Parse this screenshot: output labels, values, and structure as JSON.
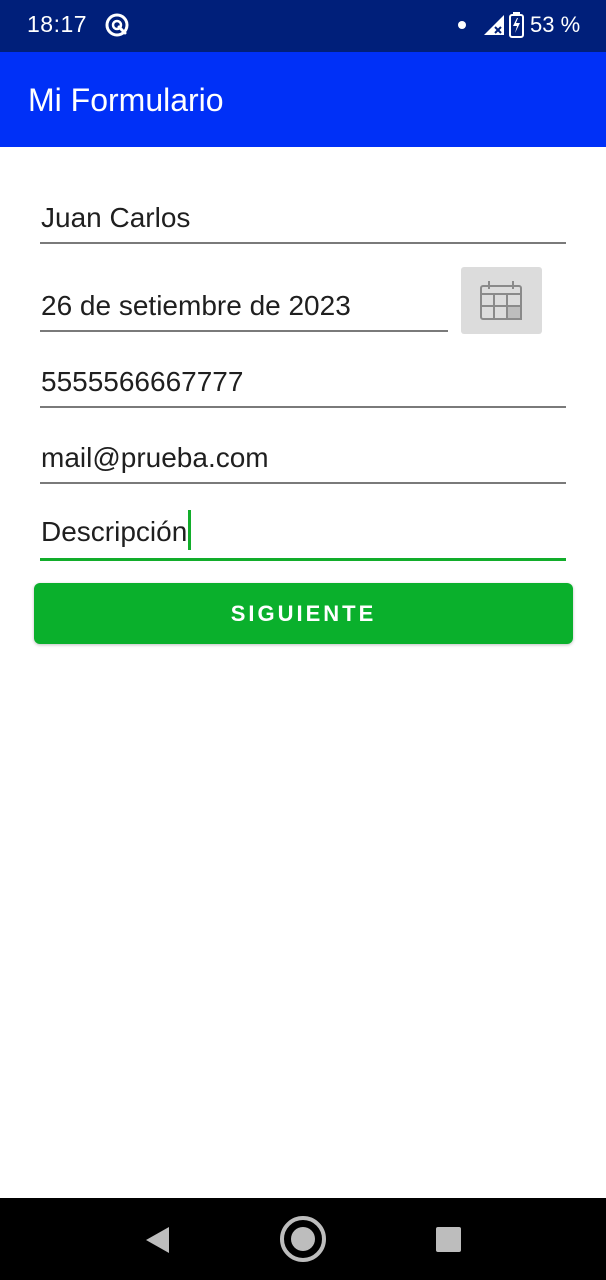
{
  "status_bar": {
    "time": "18:17",
    "battery_text": "53 %",
    "icons": [
      "app-notification-icon",
      "dot-icon",
      "signal-icon",
      "battery-icon"
    ]
  },
  "app_bar": {
    "title": "Mi Formulario"
  },
  "form": {
    "name_value": "Juan Carlos",
    "date_value": "26 de setiembre de 2023",
    "phone_value": "5555566667777",
    "email_value": "mail@prueba.com",
    "description_value": "Descripción",
    "next_button_label": "SIGUIENTE"
  },
  "colors": {
    "status_bar": "#001f7a",
    "app_bar": "#0030f7",
    "accent": "#12ad2b",
    "button": "#0ab02c"
  },
  "nav_bar": {
    "icons": [
      "back-icon",
      "home-icon",
      "recents-icon"
    ]
  }
}
